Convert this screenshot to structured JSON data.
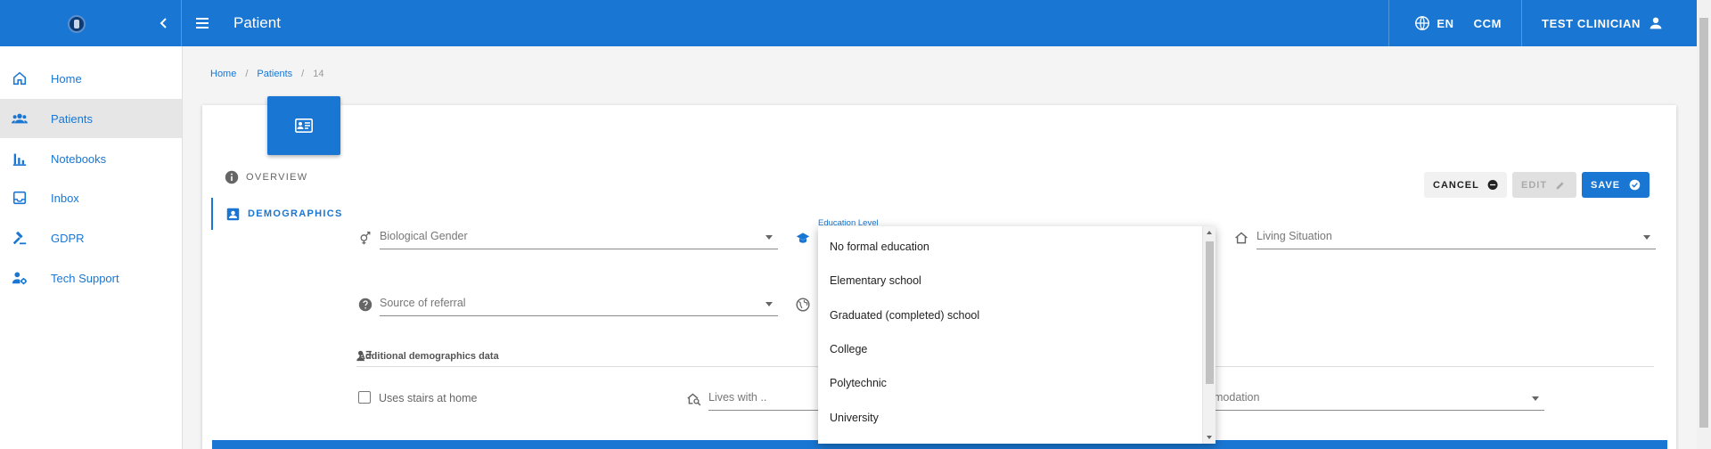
{
  "app": {
    "title": "Patient"
  },
  "topbar": {
    "language": "EN",
    "org": "CCM",
    "user": "TEST CLINICIAN"
  },
  "sidebar": {
    "items": [
      {
        "label": "Home",
        "icon": "home-icon",
        "active": false
      },
      {
        "label": "Patients",
        "icon": "people-icon",
        "active": true
      },
      {
        "label": "Notebooks",
        "icon": "bar-chart-icon",
        "active": false
      },
      {
        "label": "Inbox",
        "icon": "inbox-icon",
        "active": false
      },
      {
        "label": "GDPR",
        "icon": "gavel-icon",
        "active": false
      },
      {
        "label": "Tech Support",
        "icon": "support-agent-icon",
        "active": false
      }
    ]
  },
  "breadcrumb": {
    "home": "Home",
    "patients": "Patients",
    "sep": "/",
    "current": "14"
  },
  "tabs": {
    "overview": "OVERVIEW",
    "demographics": "DEMOGRAPHICS"
  },
  "buttons": {
    "cancel": "CANCEL",
    "edit": "EDIT",
    "save": "SAVE"
  },
  "form": {
    "biological_gender": "Biological Gender",
    "education_level_label": "Education Level",
    "living_situation": "Living Situation",
    "source_of_referral": "Source of referral",
    "additional_section": "Additional demographics data",
    "uses_stairs": "Uses stairs at home",
    "lives_with": "Lives with ..",
    "accommodation_partial": "modation"
  },
  "dropdown": {
    "options": [
      "No formal education",
      "Elementary school",
      "Graduated (completed) school",
      "College",
      "Polytechnic",
      "University"
    ]
  },
  "colors": {
    "primary": "#1976d2",
    "sidebar_active_bg": "#e6e6e6"
  }
}
